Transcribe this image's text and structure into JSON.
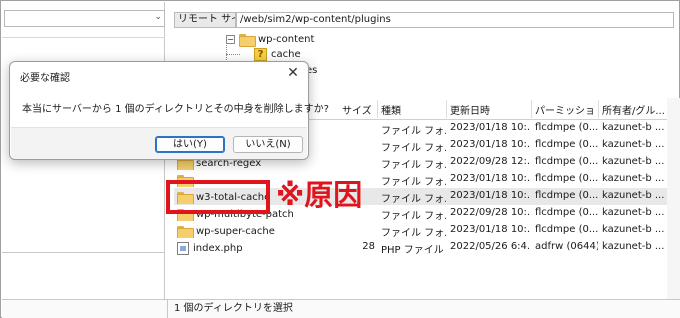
{
  "left": {
    "path_dropdown": "⌄"
  },
  "remote": {
    "label": "リモート サイト:",
    "path": "/web/sim2/wp-content/plugins"
  },
  "tree": [
    {
      "label": "wp-content",
      "type": "folder"
    },
    {
      "label": "cache",
      "type": "unknown"
    },
    {
      "label": "es",
      "type": "folder"
    }
  ],
  "columns": [
    "サイズ",
    "種類",
    "更新日時",
    "パーミッション",
    "所有者/グル..."
  ],
  "rows": [
    {
      "name": "",
      "size": "",
      "type": "ファイル フォ...",
      "modified": "2023/01/18 10:...",
      "perm": "flcdmpe (0...",
      "owner": "kazunet-b ..."
    },
    {
      "name": "",
      "size": "",
      "type": "ファイル フォ...",
      "modified": "2023/01/18 10:...",
      "perm": "flcdmpe (0...",
      "owner": "kazunet-b ..."
    },
    {
      "name": "search-regex",
      "size": "",
      "type": "ファイル フォ...",
      "modified": "2022/09/28 12:...",
      "perm": "flcdmpe (0...",
      "owner": "kazunet-b ..."
    },
    {
      "name": "",
      "size": "",
      "type": "ファイル フォ...",
      "modified": "2023/01/18 10:...",
      "perm": "flcdmpe (0...",
      "owner": "kazunet-b ..."
    },
    {
      "name": "w3-total-cache",
      "size": "",
      "type": "ファイル フォ...",
      "modified": "2023/01/18 10:...",
      "perm": "flcdmpe (0...",
      "owner": "kazunet-b ..."
    },
    {
      "name": "wp-multibyte-patch",
      "size": "",
      "type": "ファイル フォ...",
      "modified": "2022/09/28 10:...",
      "perm": "flcdmpe (0...",
      "owner": "kazunet-b ..."
    },
    {
      "name": "wp-super-cache",
      "size": "",
      "type": "ファイル フォ...",
      "modified": "2023/01/18 10:...",
      "perm": "flcdmpe (0...",
      "owner": "kazunet-b ..."
    },
    {
      "name": "index.php",
      "size": "28",
      "type": "PHP ファイル",
      "modified": "2022/05/26 6:4...",
      "perm": "adfrw (0644)",
      "owner": "kazunet-b ..."
    }
  ],
  "status": "1 個のディレクトリを選択",
  "dialog": {
    "title": "必要な確認",
    "close": "✕",
    "message": "本当にサーバーから 1 個のディレクトリとその中身を削除しますか?",
    "yes": "はい(Y)",
    "no": "いいえ(N)"
  },
  "annotation": "※原因",
  "colors": {
    "annotation_red": "#e0141c",
    "selected_row": "#e8e8e8",
    "primary_border": "#2a74c7"
  }
}
